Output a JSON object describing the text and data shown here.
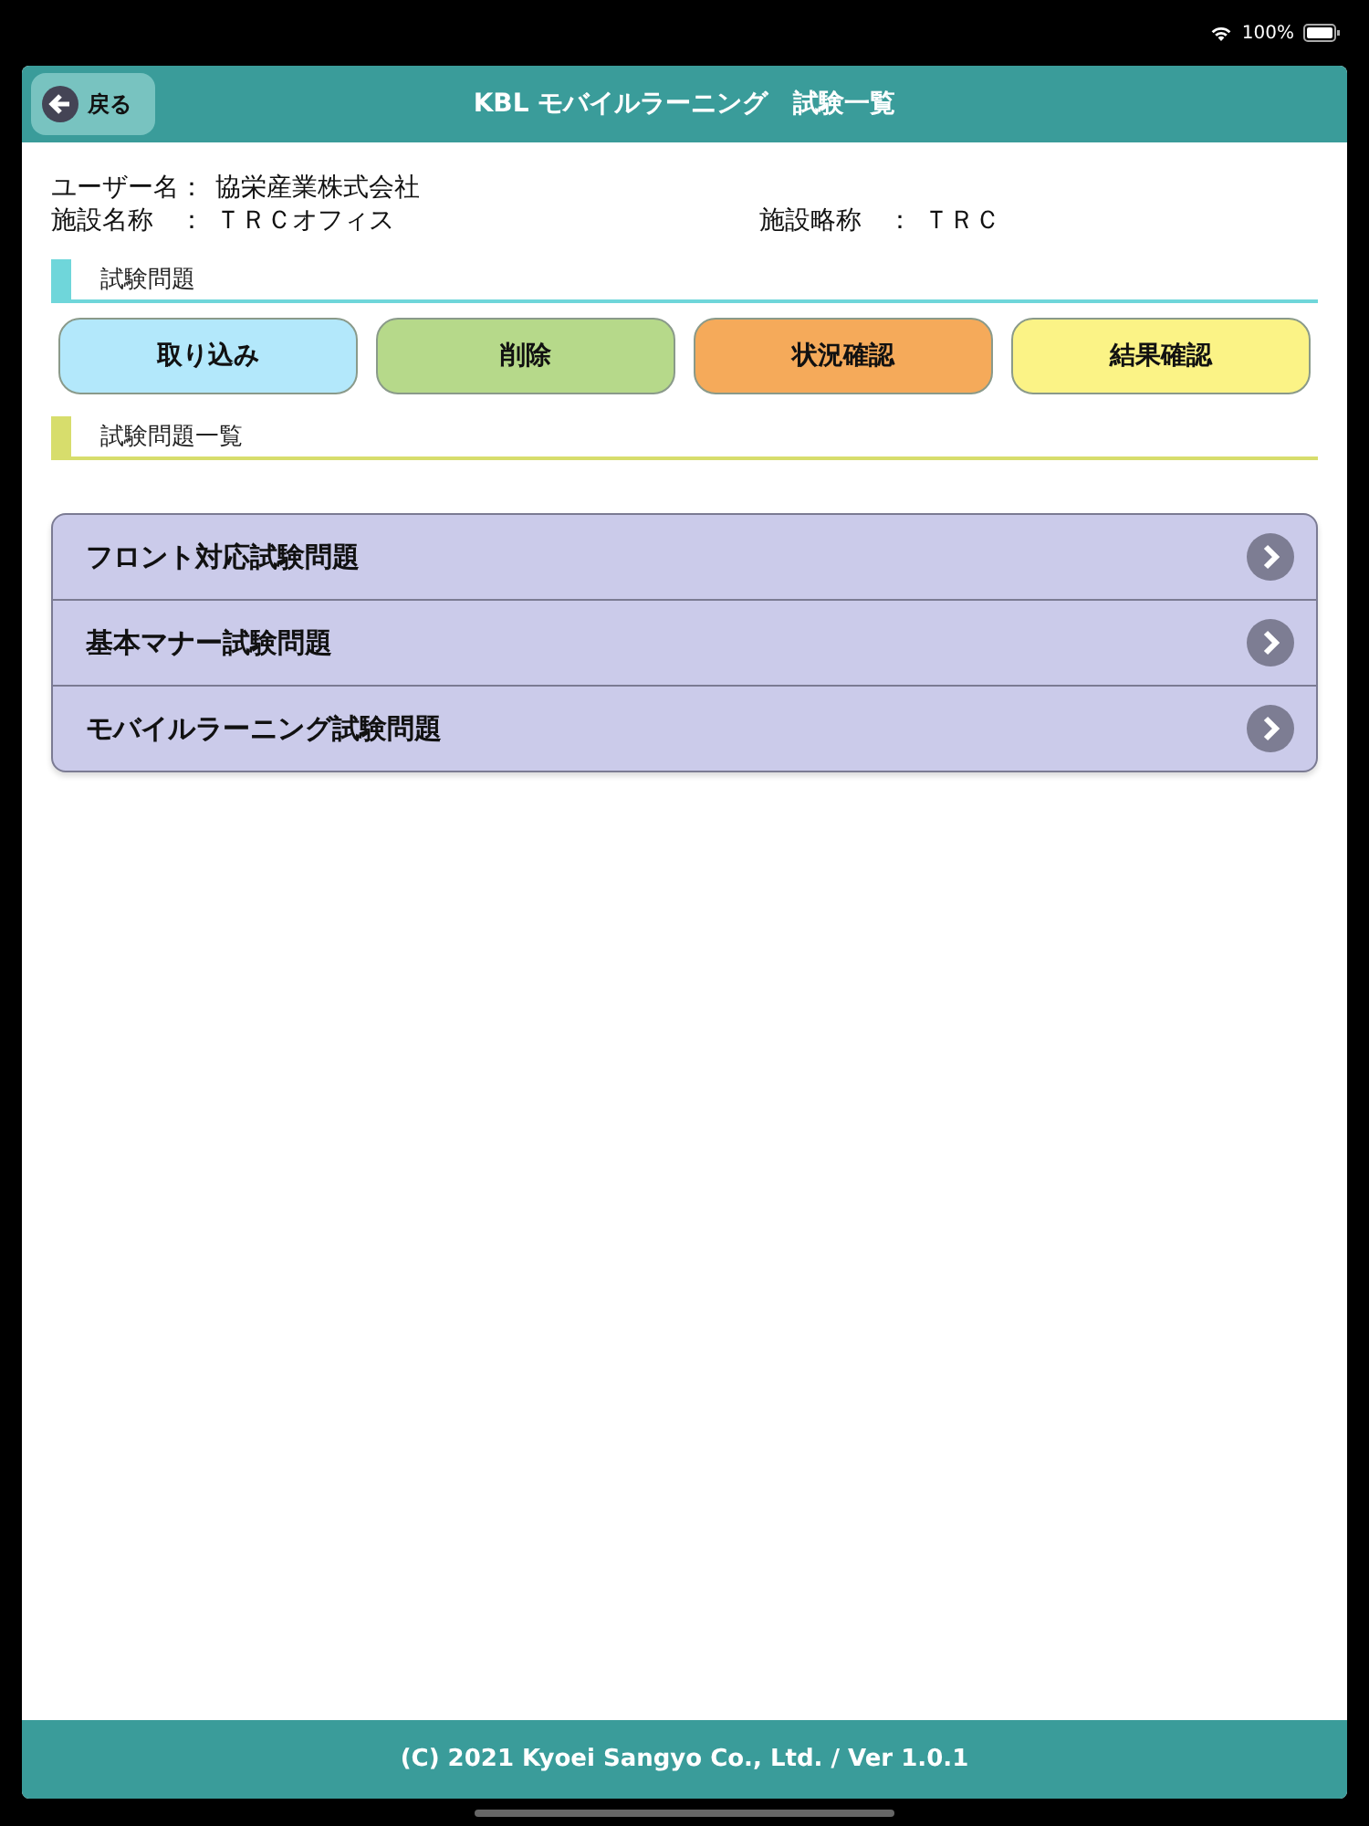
{
  "status_bar": {
    "battery": "100%"
  },
  "header": {
    "back": "戻る",
    "title": "KBL モバイルラーニング　試験一覧"
  },
  "info": {
    "user_label": "ユーザー名：",
    "user": "協栄産業株式会社",
    "facility_label": "施設名称　：",
    "facility": "ＴＲＣオフィス",
    "abbr_label": "施設略称　：",
    "abbr": "ＴＲＣ"
  },
  "sections": [
    {
      "title": "試験問題",
      "color": "#6fd6da",
      "buttons": [
        {
          "label": "取り込み",
          "color": "#b3e8fb"
        },
        {
          "label": "削除",
          "color": "#b6d98a"
        },
        {
          "label": "状況確認",
          "color": "#f5aa5a"
        },
        {
          "label": "結果確認",
          "color": "#fbf386"
        }
      ]
    },
    {
      "title": "試験問題一覧",
      "color": "#d7dd6c",
      "items": [
        {
          "label": "フロント対応試験問題"
        },
        {
          "label": "基本マナー試験問題"
        },
        {
          "label": "モバイルラーニング試験問題"
        }
      ]
    }
  ],
  "footer": "(C) 2021 Kyoei Sangyo Co., Ltd. / Ver 1.0.1"
}
